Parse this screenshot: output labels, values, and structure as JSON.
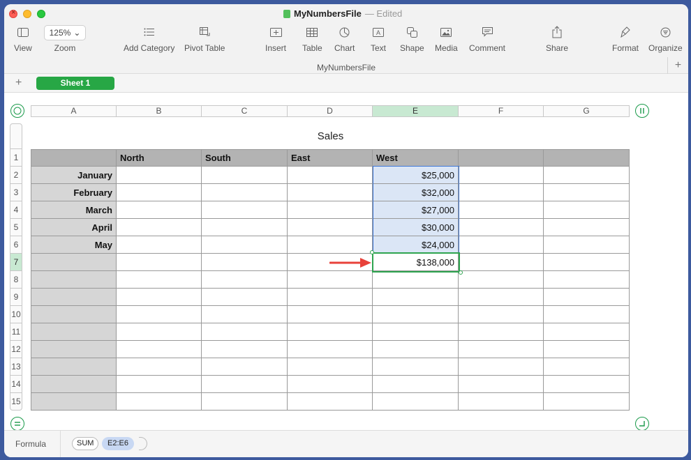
{
  "window": {
    "title": "MyNumbersFile",
    "status": "— Edited",
    "subtitle": "MyNumbersFile"
  },
  "toolbar": {
    "view": "View",
    "zoom_value": "125%",
    "zoom": "Zoom",
    "add_category": "Add Category",
    "pivot_table": "Pivot Table",
    "insert": "Insert",
    "table": "Table",
    "chart": "Chart",
    "text": "Text",
    "text_icon_letter": "A",
    "shape": "Shape",
    "media": "Media",
    "comment": "Comment",
    "share": "Share",
    "format": "Format",
    "organize": "Organize"
  },
  "sheets": {
    "active": "Sheet 1"
  },
  "columns": [
    "A",
    "B",
    "C",
    "D",
    "E",
    "F",
    "G"
  ],
  "rows": [
    "1",
    "2",
    "3",
    "4",
    "5",
    "6",
    "7",
    "8",
    "9",
    "10",
    "11",
    "12",
    "13",
    "14",
    "15"
  ],
  "table": {
    "title": "Sales",
    "headers": [
      "",
      "North",
      "South",
      "East",
      "West",
      "",
      ""
    ],
    "row_labels": [
      "January",
      "February",
      "March",
      "April",
      "May"
    ],
    "west_values": [
      "$25,000",
      "$32,000",
      "$27,000",
      "$30,000",
      "$24,000"
    ],
    "total": "$138,000"
  },
  "formula": {
    "label": "Formula",
    "function": "SUM",
    "range": "E2:E6"
  },
  "colors": {
    "accent": "#27a745",
    "selection": "#3f77d6",
    "arrow": "#e8413a"
  }
}
